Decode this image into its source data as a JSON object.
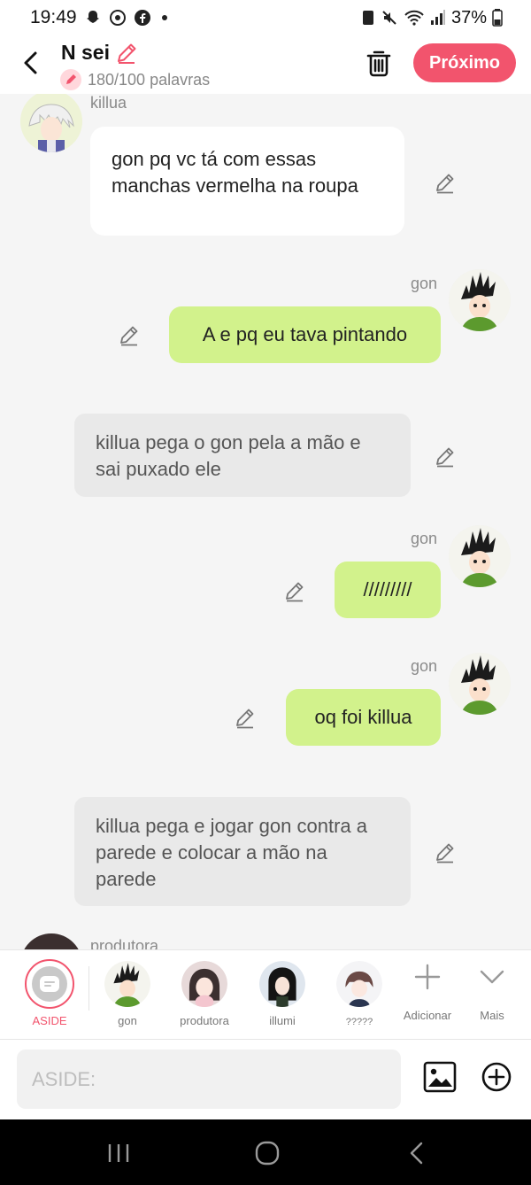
{
  "status_bar": {
    "time": "19:49",
    "battery": "37%"
  },
  "header": {
    "back_icon": "chevron-left-icon",
    "title": "N sei",
    "word_count": "180/100 palavras",
    "next_label": "Próximo"
  },
  "chat": {
    "messages": [
      {
        "type": "character",
        "side": "left",
        "name": "killua",
        "text": "gon pq vc tá com essas manchas vermelha na roupa"
      },
      {
        "type": "character",
        "side": "right",
        "name": "gon",
        "text": "A e pq eu tava pintando"
      },
      {
        "type": "aside",
        "text": "killua pega o gon pela a mão e sai puxado ele"
      },
      {
        "type": "character",
        "side": "right",
        "name": "gon",
        "text": "/////////"
      },
      {
        "type": "character",
        "side": "right",
        "name": "gon",
        "text": "oq foi killua"
      },
      {
        "type": "aside",
        "text": "killua pega e jogar gon contra a parede e colocar a mão na parede"
      },
      {
        "type": "character",
        "side": "left",
        "name": "produtora",
        "text": ""
      }
    ]
  },
  "characters": {
    "items": [
      {
        "label": "ASIDE",
        "selected": true
      },
      {
        "label": "gon"
      },
      {
        "label": "produtora"
      },
      {
        "label": "illumi"
      },
      {
        "label": "?????"
      }
    ],
    "add_label": "Adicionar",
    "more_label": "Mais"
  },
  "composer": {
    "placeholder": "ASIDE:"
  },
  "colors": {
    "accent": "#f2546d",
    "bubble_green": "#d2f28c",
    "aside_gray": "#e9e9e9"
  }
}
